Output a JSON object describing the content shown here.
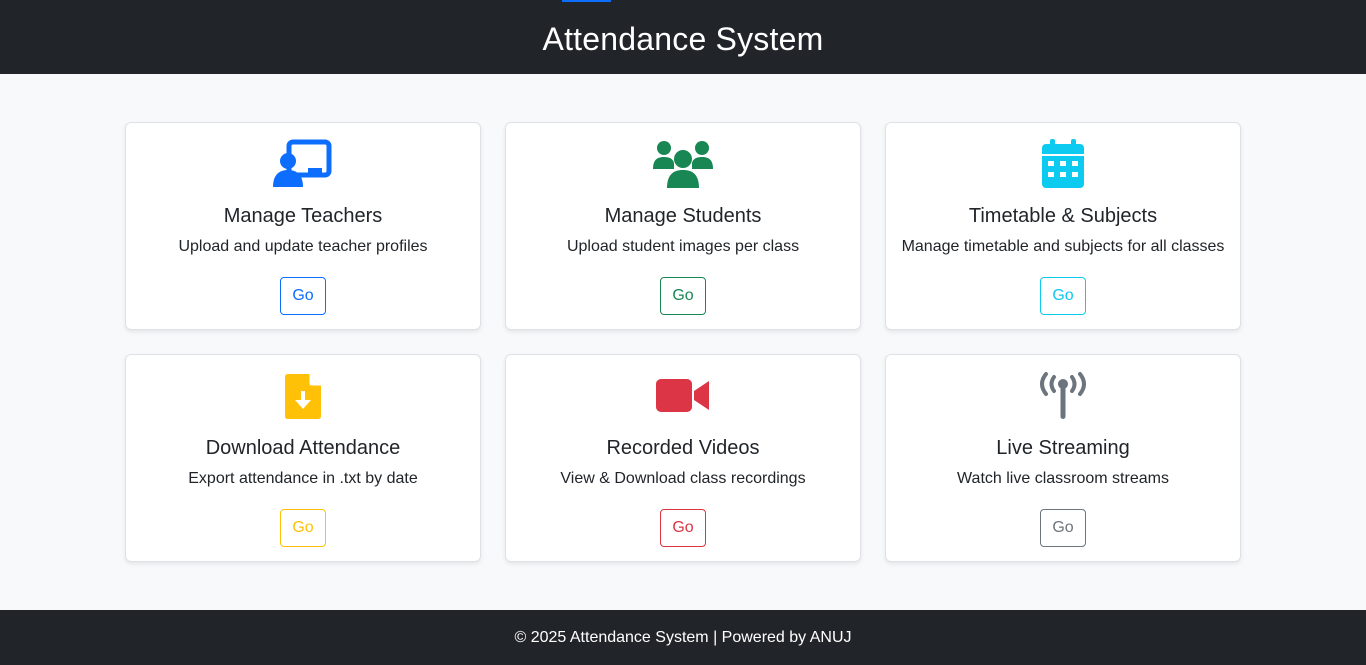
{
  "header": {
    "title": "Attendance System"
  },
  "cards": [
    {
      "title": "Manage Teachers",
      "description": "Upload and update teacher profiles",
      "button": "Go",
      "color": "#0d6efd",
      "icon": "chalkboard-teacher-icon"
    },
    {
      "title": "Manage Students",
      "description": "Upload student images per class",
      "button": "Go",
      "color": "#198754",
      "icon": "users-icon"
    },
    {
      "title": "Timetable & Subjects",
      "description": "Manage timetable and subjects for all classes",
      "button": "Go",
      "color": "#0dcaf0",
      "icon": "calendar-icon"
    },
    {
      "title": "Download Attendance",
      "description": "Export attendance in .txt by date",
      "button": "Go",
      "color": "#ffc107",
      "icon": "file-download-icon"
    },
    {
      "title": "Recorded Videos",
      "description": "View & Download class recordings",
      "button": "Go",
      "color": "#dc3545",
      "icon": "video-camera-icon"
    },
    {
      "title": "Live Streaming",
      "description": "Watch live classroom streams",
      "button": "Go",
      "color": "#6c757d",
      "icon": "broadcast-tower-icon"
    }
  ],
  "footer": {
    "text": "© 2025 Attendance System | Powered by ANUJ"
  }
}
